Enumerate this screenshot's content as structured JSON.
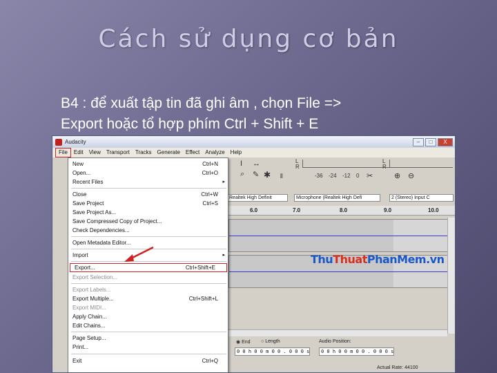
{
  "slide": {
    "title": "Cách sử dụng cơ bản",
    "bullet_glyph": "",
    "text_line1": "B4 : để xuất tập tin đã ghi âm , chọn File =>",
    "text_line2": "Export hoặc tổ hợp phím Ctrl + Shift + E"
  },
  "window": {
    "title": "Audacity",
    "menubar": [
      "File",
      "Edit",
      "View",
      "Transport",
      "Tracks",
      "Generate",
      "Effect",
      "Analyze",
      "Help"
    ],
    "active_menu": "File",
    "controls": {
      "minimize": "–",
      "maximize": "□",
      "close": "X"
    }
  },
  "file_menu": {
    "items": [
      {
        "label": "New",
        "shortcut": "Ctrl+N"
      },
      {
        "label": "Open...",
        "shortcut": "Ctrl+O"
      },
      {
        "label": "Recent Files",
        "submenu": true
      },
      {
        "label": "Close",
        "shortcut": "Ctrl+W"
      },
      {
        "label": "Save Project",
        "shortcut": "Ctrl+S"
      },
      {
        "label": "Save Project As..."
      },
      {
        "label": "Save Compressed Copy of Project..."
      },
      {
        "label": "Check Dependencies..."
      },
      {
        "label": "Open Metadata Editor..."
      },
      {
        "label": "Import",
        "submenu": true
      },
      {
        "label": "Export...",
        "shortcut": "Ctrl+Shift+E",
        "highlighted": true
      },
      {
        "label": "Export Selection...",
        "disabled": true
      },
      {
        "label": "Export Labels...",
        "disabled": true
      },
      {
        "label": "Export Multiple...",
        "shortcut": "Ctrl+Shift+L"
      },
      {
        "label": "Export MIDI...",
        "disabled": true
      },
      {
        "label": "Apply Chain..."
      },
      {
        "label": "Edit Chains..."
      },
      {
        "label": "Page Setup..."
      },
      {
        "label": "Print..."
      },
      {
        "label": "Exit",
        "shortcut": "Ctrl+Q"
      }
    ]
  },
  "toolbar": {
    "meter_letters": [
      "L",
      "R",
      "L",
      "R"
    ],
    "meter_ticks": [
      "-36",
      "-24",
      "-12",
      "0"
    ],
    "recording_device": "Realtek High Definit",
    "input_source": "Microphone (Realtek High Defi",
    "channels": "2 (Stereo) Input C"
  },
  "ruler": {
    "labels": [
      "6.0",
      "7.0",
      "8.0",
      "9.0",
      "10.0"
    ]
  },
  "selection_bar": {
    "end_label": "End",
    "length_label": "Length",
    "audio_position_label": "Audio Position:",
    "time_value": "0 0 h 0 0 m 0 0 . 0 0 0 s",
    "actual_rate": "Actual Rate: 44100"
  },
  "watermark": {
    "part1": "Thu",
    "part2": "Thuat",
    "part3": "PhanMem",
    "part4": ".vn"
  },
  "colors": {
    "highlight": "#d02020",
    "watermark_blue": "#1a58c8",
    "watermark_red": "#d83020"
  }
}
